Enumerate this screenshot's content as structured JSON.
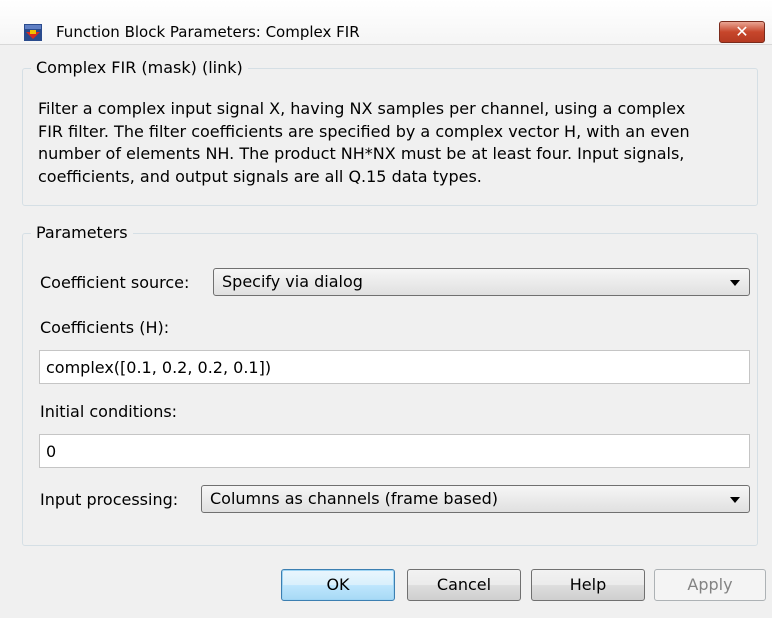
{
  "window": {
    "title": "Function Block Parameters: Complex FIR",
    "close_label": "✕"
  },
  "description_group": {
    "legend": "Complex FIR (mask) (link)",
    "lines": [
      "Filter a complex input signal X, having NX samples per channel, using a complex",
      "FIR filter. The filter coefficients are specified by a complex vector H, with an even",
      "number of elements NH. The product NH*NX must be at least four. Input signals,",
      "coefficients, and output signals are all Q.15 data types."
    ]
  },
  "parameters": {
    "legend": "Parameters",
    "coefficient_source": {
      "label": "Coefficient source:",
      "value": "Specify via dialog"
    },
    "coefficients": {
      "label": "Coefficients (H):",
      "value": "complex([0.1, 0.2, 0.2, 0.1])"
    },
    "initial_conditions": {
      "label": "Initial conditions:",
      "value": "0"
    },
    "input_processing": {
      "label": "Input processing:",
      "value": "Columns as channels (frame based)"
    }
  },
  "buttons": {
    "ok": "OK",
    "cancel": "Cancel",
    "help": "Help",
    "apply": "Apply"
  },
  "icons": {
    "app": "simulink-block-icon",
    "close": "close-icon"
  }
}
